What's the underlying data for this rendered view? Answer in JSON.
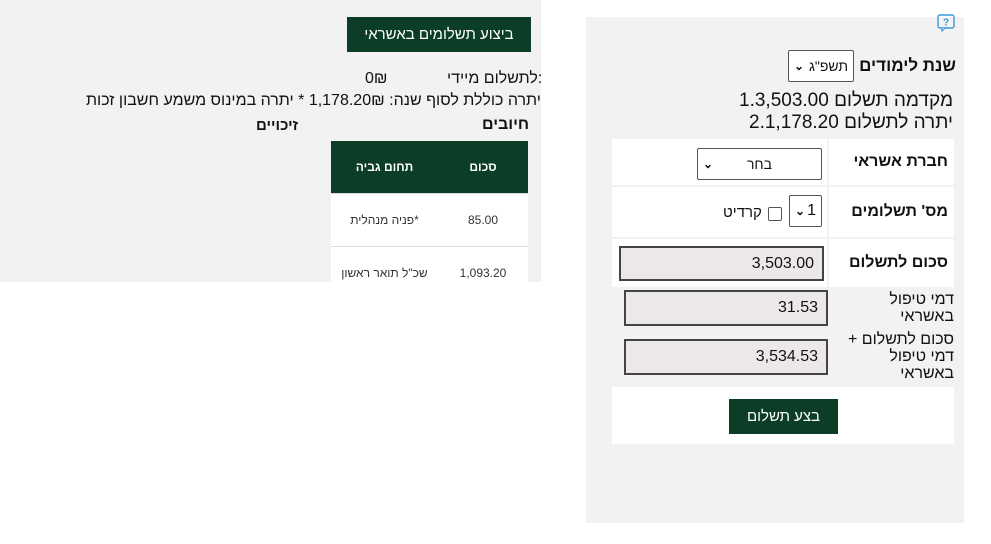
{
  "left": {
    "pay_button": "ביצוע תשלומים באשראי",
    "immediate_label": "לתשלום מיידי:",
    "immediate_value": "0₪",
    "balance_text": "יתרה כוללת לסוף שנה: 1,178.20₪ * יתרה במינוס משמע חשבון זכות",
    "charges_heading": "חיובים",
    "credits_heading": "זיכויים",
    "table": {
      "headers": [
        "תחום גביה",
        "סכום"
      ],
      "rows": [
        [
          "פניה מנהלית*",
          "85.00"
        ],
        [
          "שכ\"ל תואר ראשון",
          "1,093.20"
        ]
      ]
    }
  },
  "right": {
    "year_label": "שנת לימודים",
    "year_value": "תשפ\"ג",
    "summary_1": "1.מקדמה תשלום 3,503.00",
    "summary_2": "2.יתרה לתשלום 1,178.20",
    "company_label": "חברת אשראי",
    "company_value": "בחר",
    "installments_label": "מס' תשלומים",
    "installments_value": "1",
    "credit_label": "קרדיט",
    "amount_label": "סכום לתשלום",
    "amount_value": "3,503.00",
    "fee_label": "דמי טיפול באשראי",
    "fee_value": "31.53",
    "total_label": "סכום לתשלום + דמי טיפול באשראי",
    "total_value": "3,534.53",
    "submit": "בצע תשלום"
  },
  "colors": {
    "accent": "#0b3d27",
    "panel": "#f2f2f2",
    "readonly": "#ede8e8",
    "help": "#3a9ad9"
  }
}
